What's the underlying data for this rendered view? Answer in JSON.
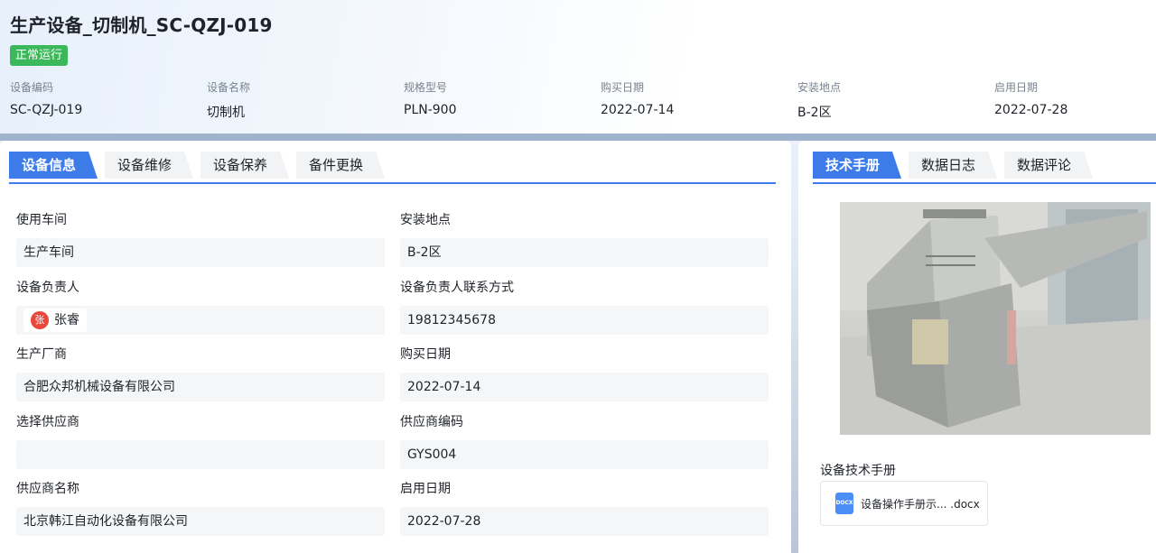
{
  "header": {
    "title": "生产设备_切制机_SC-QZJ-019",
    "status": "正常运行",
    "meta": [
      {
        "label": "设备编码",
        "value": "SC-QZJ-019"
      },
      {
        "label": "设备名称",
        "value": "切制机"
      },
      {
        "label": "规格型号",
        "value": "PLN-900"
      },
      {
        "label": "购买日期",
        "value": "2022-07-14"
      },
      {
        "label": "安装地点",
        "value": "B-2区"
      },
      {
        "label": "启用日期",
        "value": "2022-07-28"
      }
    ]
  },
  "left_tabs": [
    {
      "label": "设备信息",
      "active": true
    },
    {
      "label": "设备维修",
      "active": false
    },
    {
      "label": "设备保养",
      "active": false
    },
    {
      "label": "备件更换",
      "active": false
    }
  ],
  "fields": {
    "workshop": {
      "label": "使用车间",
      "value": "生产车间"
    },
    "install_location": {
      "label": "安装地点",
      "value": "B-2区"
    },
    "owner": {
      "label": "设备负责人",
      "avatar": "张",
      "name": "张睿"
    },
    "owner_contact": {
      "label": "设备负责人联系方式",
      "value": "19812345678"
    },
    "manufacturer": {
      "label": "生产厂商",
      "value": "合肥众邦机械设备有限公司"
    },
    "purchase_date": {
      "label": "购买日期",
      "value": "2022-07-14"
    },
    "supplier_select": {
      "label": "选择供应商",
      "value": ""
    },
    "supplier_code": {
      "label": "供应商编码",
      "value": "GYS004"
    },
    "supplier_name": {
      "label": "供应商名称",
      "value": "北京韩江自动化设备有限公司"
    },
    "start_date": {
      "label": "启用日期",
      "value": "2022-07-28"
    }
  },
  "right_tabs": [
    {
      "label": "技术手册",
      "active": true
    },
    {
      "label": "数据日志",
      "active": false
    },
    {
      "label": "数据评论",
      "active": false
    }
  ],
  "manual": {
    "section_label": "设备技术手册",
    "file_name": "设备操作手册示... .docx",
    "file_type": "DOCX"
  },
  "colors": {
    "accent": "#3d7be8",
    "status_green": "#3bb85a",
    "avatar_red": "#e8473b",
    "doc_blue": "#4a8ef7"
  }
}
